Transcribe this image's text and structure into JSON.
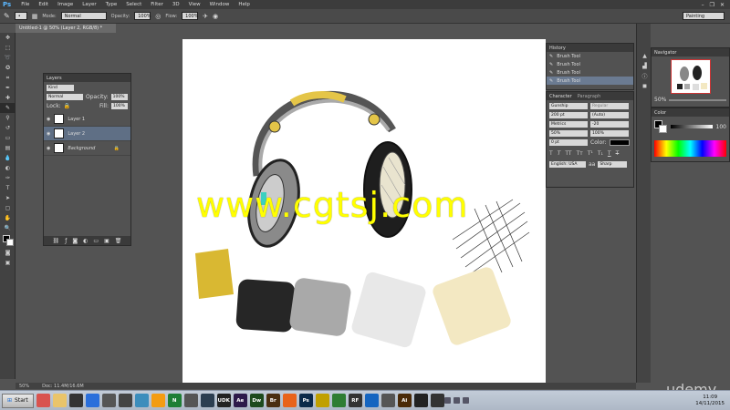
{
  "app": {
    "logo": "Ps"
  },
  "menu": [
    "File",
    "Edit",
    "Image",
    "Layer",
    "Type",
    "Select",
    "Filter",
    "3D",
    "View",
    "Window",
    "Help"
  ],
  "window_controls": {
    "minimize": "–",
    "restore": "❐",
    "close": "✕"
  },
  "options": {
    "mode_label": "Mode:",
    "mode_value": "Normal",
    "opacity_label": "Opacity:",
    "opacity_value": "100%",
    "flow_label": "Flow:",
    "flow_value": "100%",
    "workspace": "Painting"
  },
  "document_tab": "Untitled-1 @ 50% (Layer 2, RGB/8) *",
  "layers_panel": {
    "title": "Layers",
    "kind": "Kind",
    "blend": "Normal",
    "opacity_label": "Opacity:",
    "opacity_value": "100%",
    "lock_label": "Lock:",
    "fill_label": "Fill:",
    "fill_value": "100%",
    "layers": [
      {
        "name": "Layer 1",
        "selected": false
      },
      {
        "name": "Layer 2",
        "selected": true
      },
      {
        "name": "Background",
        "selected": false
      }
    ]
  },
  "history_panel": {
    "title": "History",
    "items": [
      "Brush Tool",
      "Brush Tool",
      "Brush Tool",
      "Brush Tool"
    ]
  },
  "character_panel": {
    "tab1": "Character",
    "tab2": "Paragraph",
    "font": "Gunship",
    "style": "Regular",
    "size": "200 pt",
    "leading": "(Auto)",
    "kerning": "Metrics",
    "tracking": "-20",
    "vscale": "50%",
    "hscale": "100%",
    "baseline": "0 pt",
    "color_label": "Color:",
    "language": "English: USA",
    "aa_label": "aa",
    "antialias": "Sharp"
  },
  "navigator_panel": {
    "title": "Navigator",
    "zoom": "50%"
  },
  "color_panel": {
    "title": "Color",
    "r_value": "100"
  },
  "status": {
    "zoom": "50%",
    "doc": "Doc: 11.4M/16.6M"
  },
  "watermark": "www.cgtsj.com",
  "udemy": "udemy",
  "taskbar": {
    "start": "Start",
    "time": "11:09",
    "date": "14/11/2015",
    "apps": [
      {
        "label": "",
        "color": "#d9534f"
      },
      {
        "label": "",
        "color": "#e9c46a"
      },
      {
        "label": "",
        "color": "#333333"
      },
      {
        "label": "",
        "color": "#2a6fdb"
      },
      {
        "label": "",
        "color": "#555555"
      },
      {
        "label": "",
        "color": "#444444"
      },
      {
        "label": "",
        "color": "#3c8dbc"
      },
      {
        "label": "",
        "color": "#f39c12"
      },
      {
        "label": "N",
        "color": "#1e7e34"
      },
      {
        "label": "",
        "color": "#555555"
      },
      {
        "label": "",
        "color": "#2c3e50"
      },
      {
        "label": "UDK",
        "color": "#222222"
      },
      {
        "label": "Ae",
        "color": "#2d1a4a"
      },
      {
        "label": "Dw",
        "color": "#1d4a1d"
      },
      {
        "label": "Br",
        "color": "#4a2e10"
      },
      {
        "label": "",
        "color": "#e8631a"
      },
      {
        "label": "Ps",
        "color": "#0b2a4a"
      },
      {
        "label": "",
        "color": "#c0a000"
      },
      {
        "label": "",
        "color": "#2e7d32"
      },
      {
        "label": "RF",
        "color": "#333333"
      },
      {
        "label": "",
        "color": "#1565c0"
      },
      {
        "label": "",
        "color": "#555555"
      },
      {
        "label": "Ai",
        "color": "#4a2a08"
      },
      {
        "label": "",
        "color": "#222222"
      },
      {
        "label": "",
        "color": "#333333"
      }
    ]
  }
}
